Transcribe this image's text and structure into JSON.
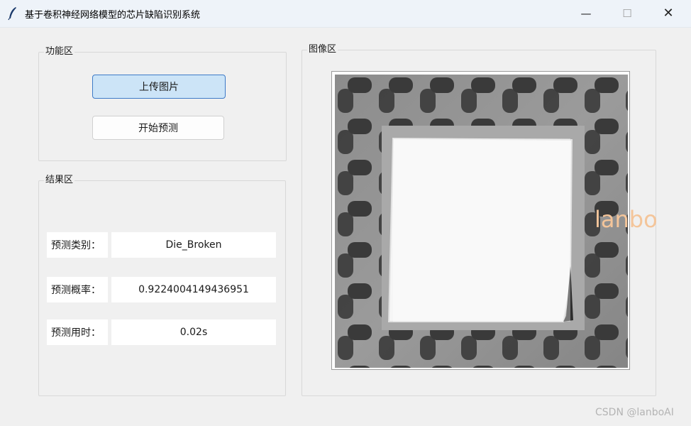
{
  "window": {
    "title": "基于卷积神经网络模型的芯片缺陷识别系统",
    "controls": {
      "minimize": "—",
      "maximize": "☐",
      "close": "✕"
    }
  },
  "function_area": {
    "label": "功能区",
    "upload_button": "上传图片",
    "predict_button": "开始预测"
  },
  "result_area": {
    "label": "结果区",
    "rows": [
      {
        "label": "预测类别：",
        "value": "Die_Broken"
      },
      {
        "label": "预测概率：",
        "value": "0.9224004149436951"
      },
      {
        "label": "预测用时：",
        "value": "0.02s"
      }
    ]
  },
  "image_area": {
    "label": "图像区",
    "overlay_text": "lanbo"
  },
  "watermark": "CSDN @lanboAI",
  "colors": {
    "accent": "#3d7ac7",
    "upload_button_bg": "#cce4f7",
    "titlebar_bg": "#eef3f9",
    "overlay_text": "#f4c59a"
  }
}
